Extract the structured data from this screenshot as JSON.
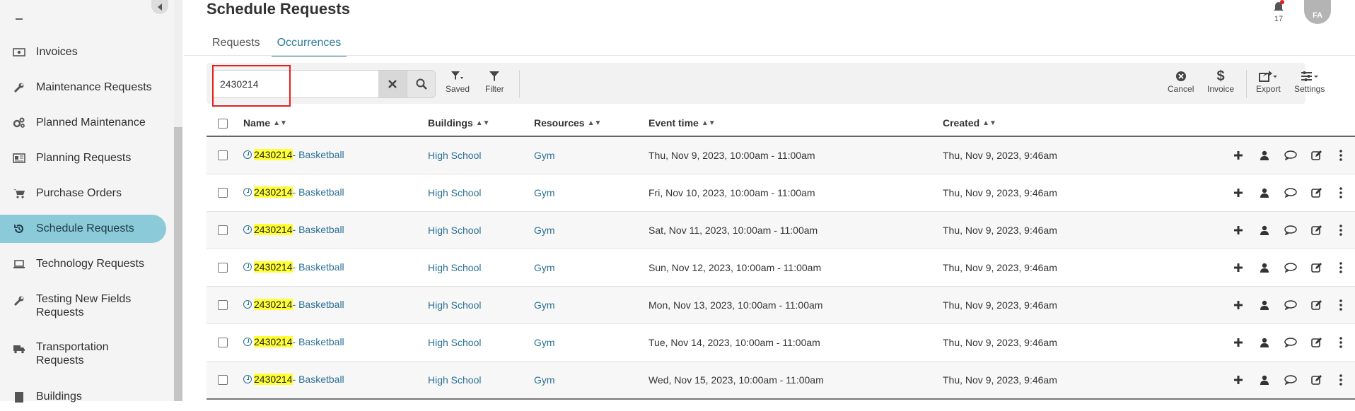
{
  "sidebar": {
    "items": [
      {
        "label": "Invoices",
        "icon": "money-icon"
      },
      {
        "label": "Maintenance Requests",
        "icon": "wrench-icon"
      },
      {
        "label": "Planned Maintenance",
        "icon": "gears-icon"
      },
      {
        "label": "Planning Requests",
        "icon": "newspaper-icon"
      },
      {
        "label": "Purchase Orders",
        "icon": "cart-icon"
      },
      {
        "label": "Schedule Requests",
        "icon": "history-icon",
        "active": true
      },
      {
        "label": "Technology Requests",
        "icon": "laptop-icon"
      },
      {
        "label": "Testing New Fields Requests",
        "icon": "wrench-icon"
      },
      {
        "label": "Transportation Requests",
        "icon": "truck-icon"
      },
      {
        "label": "Buildings",
        "icon": "building-icon"
      }
    ]
  },
  "header": {
    "title": "Schedule Requests",
    "notifications_count": "17",
    "avatar_initials": "FA"
  },
  "tabs": [
    {
      "label": "Requests"
    },
    {
      "label": "Occurrences",
      "active": true
    }
  ],
  "toolbar": {
    "search_value": "2430214",
    "saved_label": "Saved",
    "filter_label": "Filter",
    "cancel_label": "Cancel",
    "invoice_label": "Invoice",
    "export_label": "Export",
    "settings_label": "Settings"
  },
  "table": {
    "columns": {
      "name": "Name",
      "buildings": "Buildings",
      "resources": "Resources",
      "event_time": "Event time",
      "created": "Created"
    },
    "rows": [
      {
        "id": "2430214",
        "name_suffix": " - Basketball",
        "building": "High School",
        "resource": "Gym",
        "event_time": "Thu, Nov 9, 2023, 10:00am - 11:00am",
        "created": "Thu, Nov 9, 2023, 9:46am"
      },
      {
        "id": "2430214",
        "name_suffix": " - Basketball",
        "building": "High School",
        "resource": "Gym",
        "event_time": "Fri, Nov 10, 2023, 10:00am - 11:00am",
        "created": "Thu, Nov 9, 2023, 9:46am"
      },
      {
        "id": "2430214",
        "name_suffix": " - Basketball",
        "building": "High School",
        "resource": "Gym",
        "event_time": "Sat, Nov 11, 2023, 10:00am - 11:00am",
        "created": "Thu, Nov 9, 2023, 9:46am"
      },
      {
        "id": "2430214",
        "name_suffix": " - Basketball",
        "building": "High School",
        "resource": "Gym",
        "event_time": "Sun, Nov 12, 2023, 10:00am - 11:00am",
        "created": "Thu, Nov 9, 2023, 9:46am"
      },
      {
        "id": "2430214",
        "name_suffix": " - Basketball",
        "building": "High School",
        "resource": "Gym",
        "event_time": "Mon, Nov 13, 2023, 10:00am - 11:00am",
        "created": "Thu, Nov 9, 2023, 9:46am"
      },
      {
        "id": "2430214",
        "name_suffix": " - Basketball",
        "building": "High School",
        "resource": "Gym",
        "event_time": "Tue, Nov 14, 2023, 10:00am - 11:00am",
        "created": "Thu, Nov 9, 2023, 9:46am"
      },
      {
        "id": "2430214",
        "name_suffix": " - Basketball",
        "building": "High School",
        "resource": "Gym",
        "event_time": "Wed, Nov 15, 2023, 10:00am - 11:00am",
        "created": "Thu, Nov 9, 2023, 9:46am"
      }
    ]
  },
  "colors": {
    "accent": "#2c7c9a",
    "active_nav": "#8bcbd9",
    "highlight": "#ffff33",
    "annotation_box": "#e41f1f"
  }
}
